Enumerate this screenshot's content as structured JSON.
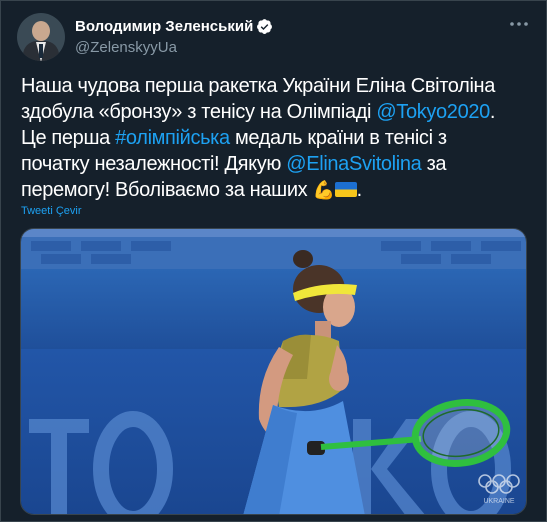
{
  "author": {
    "name": "Володимир Зеленський",
    "handle": "@ZelenskyyUa",
    "verified_icon": "verified-badge-icon",
    "avatar_icon": "avatar-portrait"
  },
  "tweet": {
    "line1": "Наша чудова перша ракетка України Еліна Світоліна",
    "line2_pre": "здобула «бронзу» з тенісу на Олімпіаді ",
    "line2_link": "@Tokyo2020",
    "line2_post": ".",
    "line3_pre": "Це перша ",
    "line3_link": "#олімпійська",
    "line3_post": " медаль країни в тенісі з",
    "line4_pre": "початку незалежності! Дякую ",
    "line4_link": "@ElinaSvitolina",
    "line4_post": " за",
    "line5": "перемогу! Вболіваємо за наших ",
    "emoji_flex": "💪",
    "emoji_flag": "🇺🇦",
    "line5_end": ".",
    "translate_label": "Tweeti Çevir"
  },
  "photo": {
    "watermark_text": "TOKYO",
    "team_text": "UKRAINE"
  },
  "colors": {
    "background": "#15202b",
    "link": "#1da1f2",
    "secondary": "#8899a6"
  }
}
